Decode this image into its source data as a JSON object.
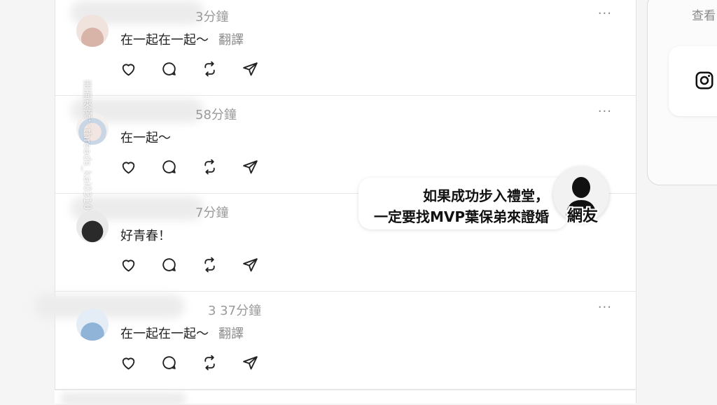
{
  "posts": [
    {
      "time": "3分鐘",
      "text": "在一起在一起～",
      "translate": "翻譯"
    },
    {
      "time": "58分鐘",
      "text": "在一起～",
      "translate": ""
    },
    {
      "time": "7分鐘",
      "text": "好青春！",
      "translate": ""
    },
    {
      "time": "3 37分鐘",
      "text": "在一起在一起～",
      "translate": "翻譯"
    }
  ],
  "more_label": "···",
  "watermark": "畫面來源：threads_kai0310",
  "sidebar": {
    "see_more": "查看"
  },
  "caption": {
    "line1": "如果成功步入禮堂，",
    "line2": "一定要找MVP葉保弟來證婚",
    "speaker": "網友"
  },
  "icons": [
    "heart-icon",
    "comment-icon",
    "repost-icon",
    "share-icon",
    "instagram-icon"
  ]
}
